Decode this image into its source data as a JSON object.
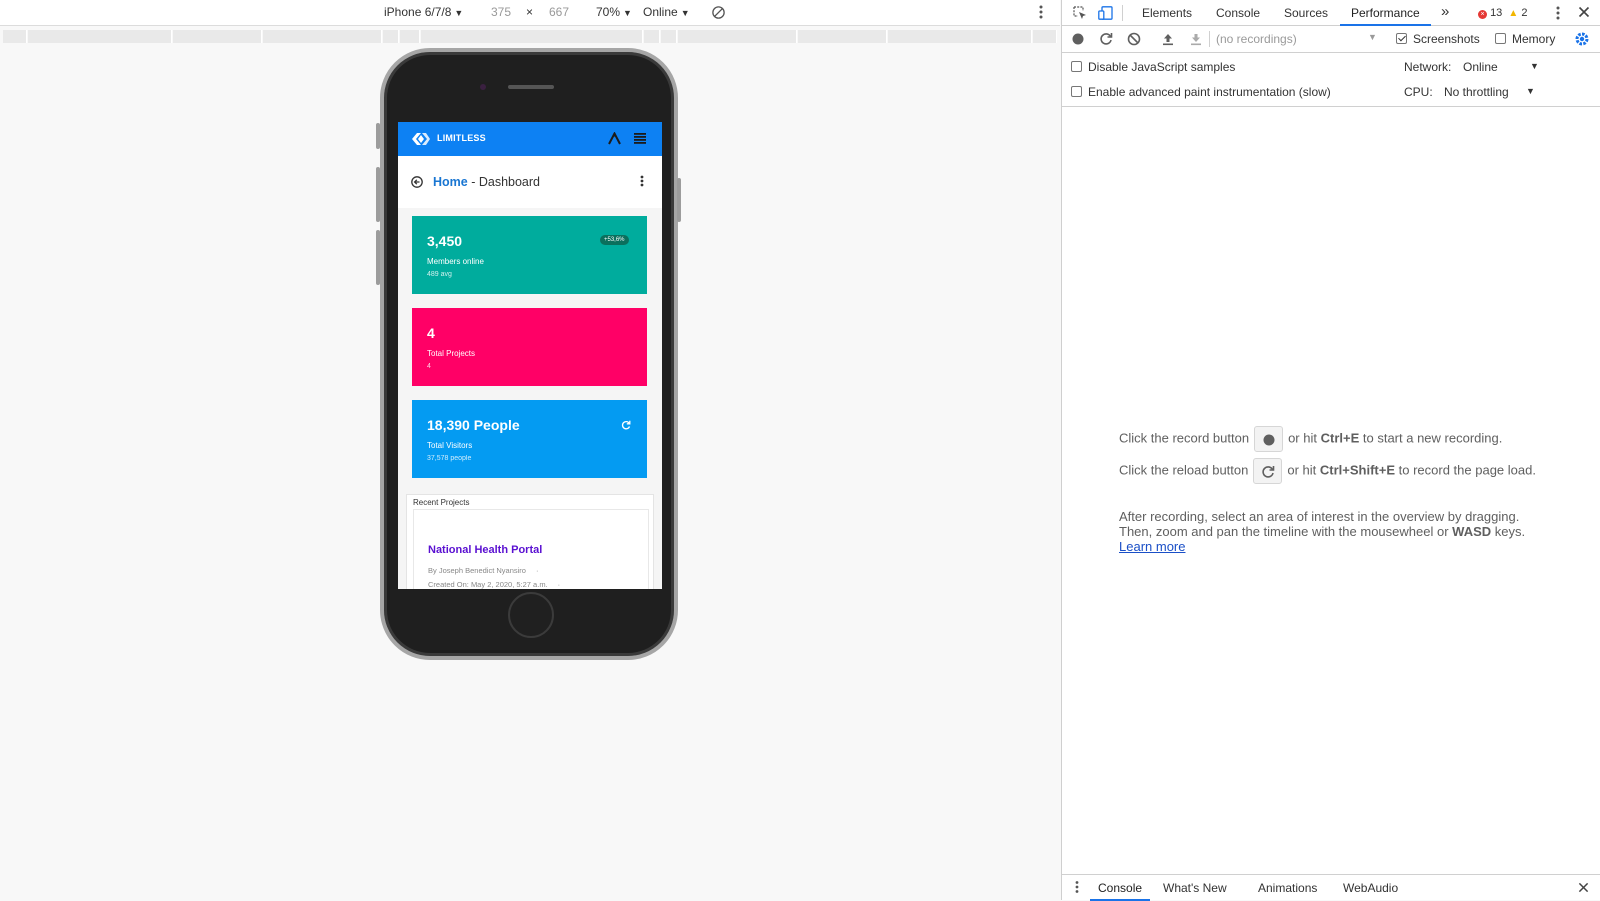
{
  "device_toolbar": {
    "device": "iPhone 6/7/8",
    "width": "375",
    "times": "×",
    "height": "667",
    "zoom": "70%",
    "network": "Online"
  },
  "app": {
    "brand": "LIMITLESS",
    "breadcrumb_home": "Home",
    "breadcrumb_sep": " - ",
    "breadcrumb_page": "Dashboard",
    "cards": [
      {
        "value": "3,450",
        "label": "Members online",
        "sub": "489 avg",
        "badge": "+53,6%",
        "color": "#00ac9d"
      },
      {
        "value": "4",
        "label": "Total Projects",
        "sub": "4",
        "color": "#ff0066"
      },
      {
        "value": "18,390 People",
        "label": "Total Visitors",
        "sub": "37,578 people",
        "color": "#049bf2"
      }
    ],
    "recent": {
      "title": "Recent Projects",
      "project_name": "National Health Portal",
      "author": "By Joseph Benedict Nyansiro",
      "created": "Created On: May 2, 2020, 5:27 a.m.",
      "dot": "·"
    }
  },
  "devtools": {
    "tabs": [
      "Elements",
      "Console",
      "Sources",
      "Performance"
    ],
    "more_tabs": "»",
    "errors": "13",
    "warnings": "2",
    "recordings_placeholder": "(no recordings)",
    "screenshots_label": "Screenshots",
    "memory_label": "Memory",
    "disable_js_label": "Disable JavaScript samples",
    "paint_label": "Enable advanced paint instrumentation (slow)",
    "network_label": "Network:",
    "network_value": "Online",
    "cpu_label": "CPU:",
    "cpu_value": "No throttling",
    "landing": {
      "record_pre": "Click the record button",
      "record_mid": "or hit",
      "record_key": "Ctrl+E",
      "record_post": "to start a new recording.",
      "reload_pre": "Click the reload button",
      "reload_mid": "or hit",
      "reload_key": "Ctrl+Shift+E",
      "reload_post": "to record the page load.",
      "after_1": "After recording, select an area of interest in the overview by dragging.",
      "after_2_pre": "Then, zoom and pan the timeline with the mousewheel or",
      "after_2_key": "WASD",
      "after_2_post": "keys.",
      "learn_more": "Learn more"
    },
    "drawer_tabs": [
      "Console",
      "What's New",
      "Animations",
      "WebAudio"
    ]
  },
  "colors": {
    "navbar": "#0d81f3",
    "accent_tab": "#1a73e8",
    "error": "#e53935",
    "warning": "#f2b600"
  }
}
